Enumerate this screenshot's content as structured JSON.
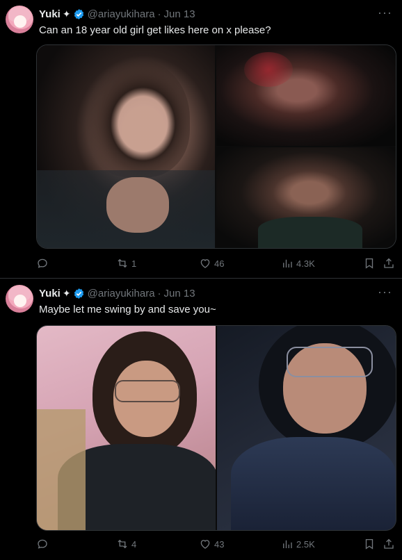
{
  "tweets": [
    {
      "name": "Yuki",
      "name_symbol": "✦",
      "handle": "@ariayukihara",
      "separator": "·",
      "date": "Jun 13",
      "more": "···",
      "text": "Can an 18 year old girl get likes here on x please?",
      "media_count": 3,
      "actions": {
        "reply": "",
        "retweets": "1",
        "likes": "46",
        "views": "4.3K"
      }
    },
    {
      "name": "Yuki",
      "name_symbol": "✦",
      "handle": "@ariayukihara",
      "separator": "·",
      "date": "Jun 13",
      "more": "···",
      "text": "Maybe let me swing by and save you~",
      "media_count": 2,
      "actions": {
        "reply": "",
        "retweets": "4",
        "likes": "43",
        "views": "2.5K"
      }
    }
  ],
  "colors": {
    "background": "#000000",
    "text": "#e7e9ea",
    "muted": "#71767b",
    "verified": "#1d9bf0",
    "border": "#2f3336"
  },
  "icons": [
    "reply-icon",
    "retweet-icon",
    "like-icon",
    "views-icon",
    "bookmark-icon",
    "share-icon",
    "verified-badge-icon",
    "more-icon"
  ]
}
